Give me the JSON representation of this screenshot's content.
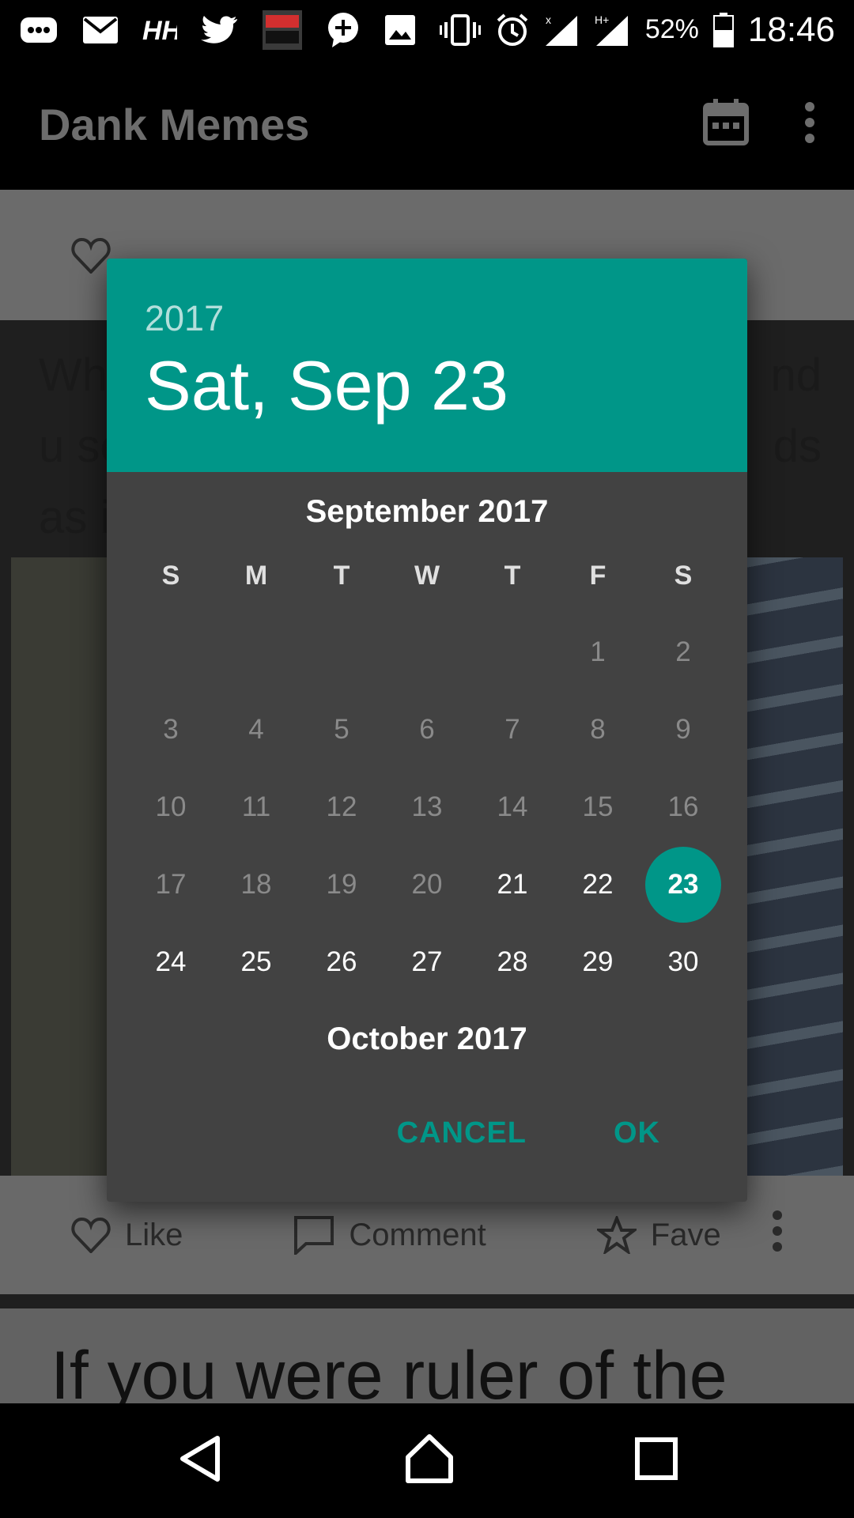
{
  "status_bar": {
    "battery": "52%",
    "time": "18:46"
  },
  "app_bar": {
    "title": "Dank Memes"
  },
  "background": {
    "meme_text_lines": [
      "Wh",
      "u se",
      "as i"
    ],
    "meme_text_right": [
      "nd",
      "ds"
    ],
    "actions": {
      "like": "Like",
      "comment": "Comment",
      "fave": "Fave"
    },
    "next_meme_text": "If you were ruler of the"
  },
  "date_picker": {
    "year": "2017",
    "selected_date": "Sat, Sep 23",
    "month_title": "September 2017",
    "weekdays": [
      "S",
      "M",
      "T",
      "W",
      "T",
      "F",
      "S"
    ],
    "next_month_title": "October 2017",
    "cancel_label": "CANCEL",
    "ok_label": "OK",
    "accent_color": "#009688"
  }
}
